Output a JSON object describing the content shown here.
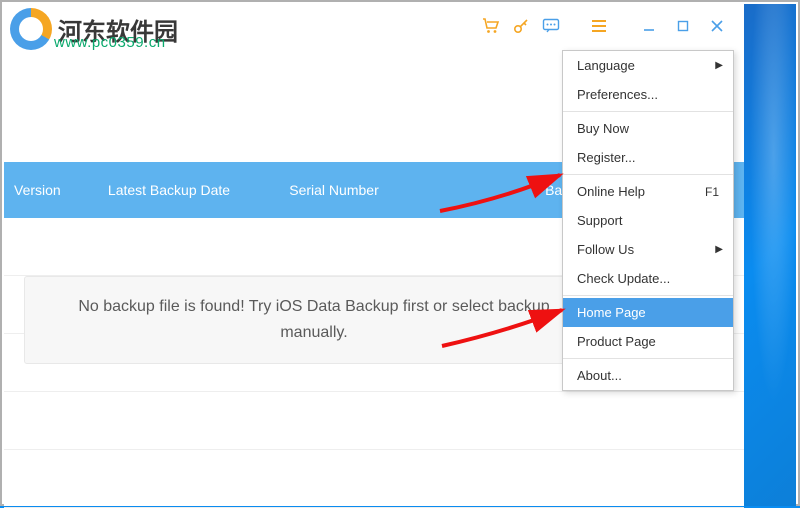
{
  "branding": {
    "siteName": "河东软件园",
    "siteUrl": "www.pc0359.cn"
  },
  "titlebar": {
    "cartIcon": "cart-icon",
    "keyIcon": "key-icon",
    "chatIcon": "chat-icon",
    "menuIcon": "menu-icon"
  },
  "table": {
    "headers": {
      "version": "Version",
      "backupDate": "Latest Backup Date",
      "serial": "Serial Number",
      "size": "Backup Size"
    }
  },
  "message": "No backup file is found! Try iOS Data Backup first or select backup manually.",
  "menu": {
    "language": "Language",
    "preferences": "Preferences...",
    "buyNow": "Buy Now",
    "register": "Register...",
    "onlineHelp": "Online Help",
    "onlineHelpKey": "F1",
    "support": "Support",
    "followUs": "Follow Us",
    "checkUpdate": "Check Update...",
    "homePage": "Home Page",
    "productPage": "Product Page",
    "about": "About..."
  }
}
